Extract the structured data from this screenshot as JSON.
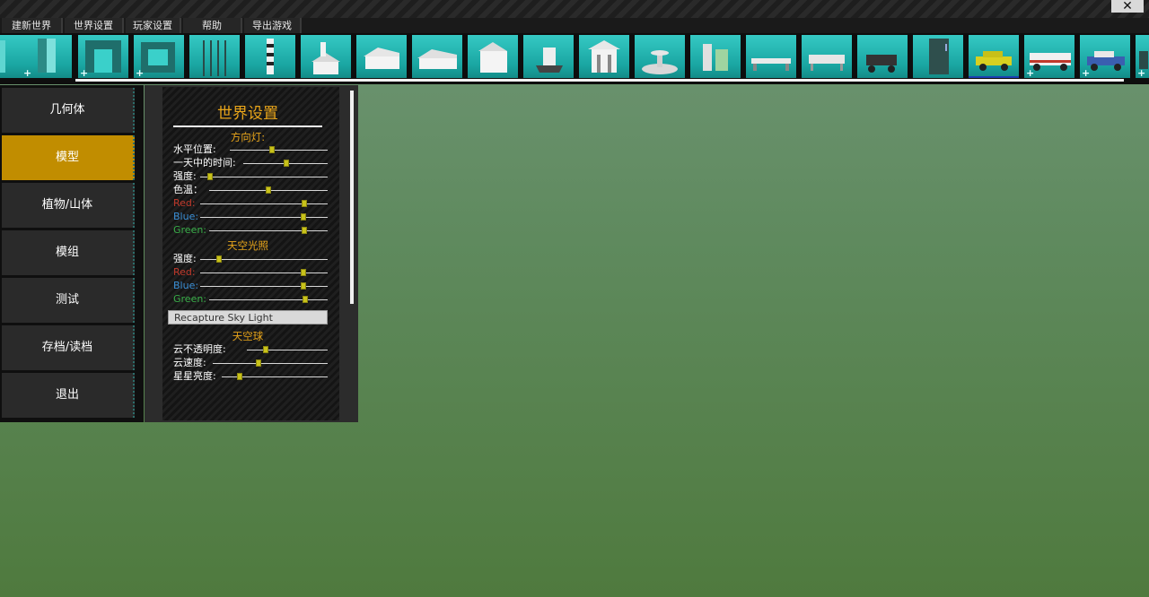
{
  "window": {
    "close_label": "✕"
  },
  "menu": [
    {
      "label": "建新世界"
    },
    {
      "label": "世界设置"
    },
    {
      "label": "玩家设置"
    },
    {
      "label": "帮助"
    },
    {
      "label": "导出游戏"
    }
  ],
  "thumbnails": [
    {
      "icon": "wall-segment-icon",
      "plus": true
    },
    {
      "icon": "wall-panel-icon",
      "plus": true
    },
    {
      "icon": "archway-icon",
      "plus": true
    },
    {
      "icon": "window-frame-icon",
      "plus": true
    },
    {
      "icon": "fence-poles-icon",
      "plus": false
    },
    {
      "icon": "lighthouse-icon",
      "plus": false
    },
    {
      "icon": "church-icon",
      "plus": false
    },
    {
      "icon": "house-icon",
      "plus": false
    },
    {
      "icon": "ranch-house-icon",
      "plus": false
    },
    {
      "icon": "two-story-house-icon",
      "plus": false
    },
    {
      "icon": "ship-icon",
      "plus": false
    },
    {
      "icon": "gazebo-icon",
      "plus": false
    },
    {
      "icon": "fountain-icon",
      "plus": false
    },
    {
      "icon": "shelf-icon",
      "plus": false
    },
    {
      "icon": "bench-icon",
      "plus": false
    },
    {
      "icon": "table-icon",
      "plus": false
    },
    {
      "icon": "cart-icon",
      "plus": false
    },
    {
      "icon": "fridge-icon",
      "plus": false
    },
    {
      "icon": "taxi-icon",
      "plus": false,
      "selected": true
    },
    {
      "icon": "fire-truck-icon",
      "plus": true
    },
    {
      "icon": "police-car-icon",
      "plus": true
    },
    {
      "icon": "partial-model-icon",
      "plus": true
    }
  ],
  "categories": [
    {
      "label": "几何体",
      "active": false
    },
    {
      "label": "模型",
      "active": true
    },
    {
      "label": "植物/山体",
      "active": false
    },
    {
      "label": "模组",
      "active": false
    },
    {
      "label": "测试",
      "active": false
    },
    {
      "label": "存档/读档",
      "active": false
    },
    {
      "label": "退出",
      "active": false
    }
  ],
  "panel": {
    "title": "世界设置",
    "directional_light": {
      "heading": "方向灯:",
      "rows": [
        {
          "label": "水平位置:",
          "value": 0.43,
          "color": "white"
        },
        {
          "label": "一天中的时间:",
          "value": 0.51,
          "color": "white"
        },
        {
          "label": "强度:",
          "value": 0.08,
          "color": "white"
        },
        {
          "label": "色温：",
          "value": 0.5,
          "color": "white"
        },
        {
          "label": "Red:",
          "value": 0.82,
          "color": "red"
        },
        {
          "label": "Blue:",
          "value": 0.81,
          "color": "blue"
        },
        {
          "label": "Green:",
          "value": 0.8,
          "color": "green"
        }
      ]
    },
    "sky_light": {
      "heading": "天空光照",
      "rows": [
        {
          "label": "强度:",
          "value": 0.15,
          "color": "white"
        },
        {
          "label": "Red:",
          "value": 0.81,
          "color": "red"
        },
        {
          "label": "Blue:",
          "value": 0.81,
          "color": "blue"
        },
        {
          "label": "Green:",
          "value": 0.81,
          "color": "green"
        }
      ]
    },
    "recapture_button": "Recapture Sky Light",
    "sky_sphere": {
      "heading": "天空球",
      "rows": [
        {
          "label": "云不透明度:",
          "value": 0.23,
          "color": "white"
        },
        {
          "label": "云速度:",
          "value": 0.4,
          "color": "white"
        },
        {
          "label": "星星亮度:",
          "value": 0.17,
          "color": "white"
        }
      ]
    }
  },
  "colors": {
    "accent": "#c18d00",
    "heading": "#e8a51a",
    "thumb_bg": "#2ab8b4",
    "knob": "#c8c21a"
  }
}
